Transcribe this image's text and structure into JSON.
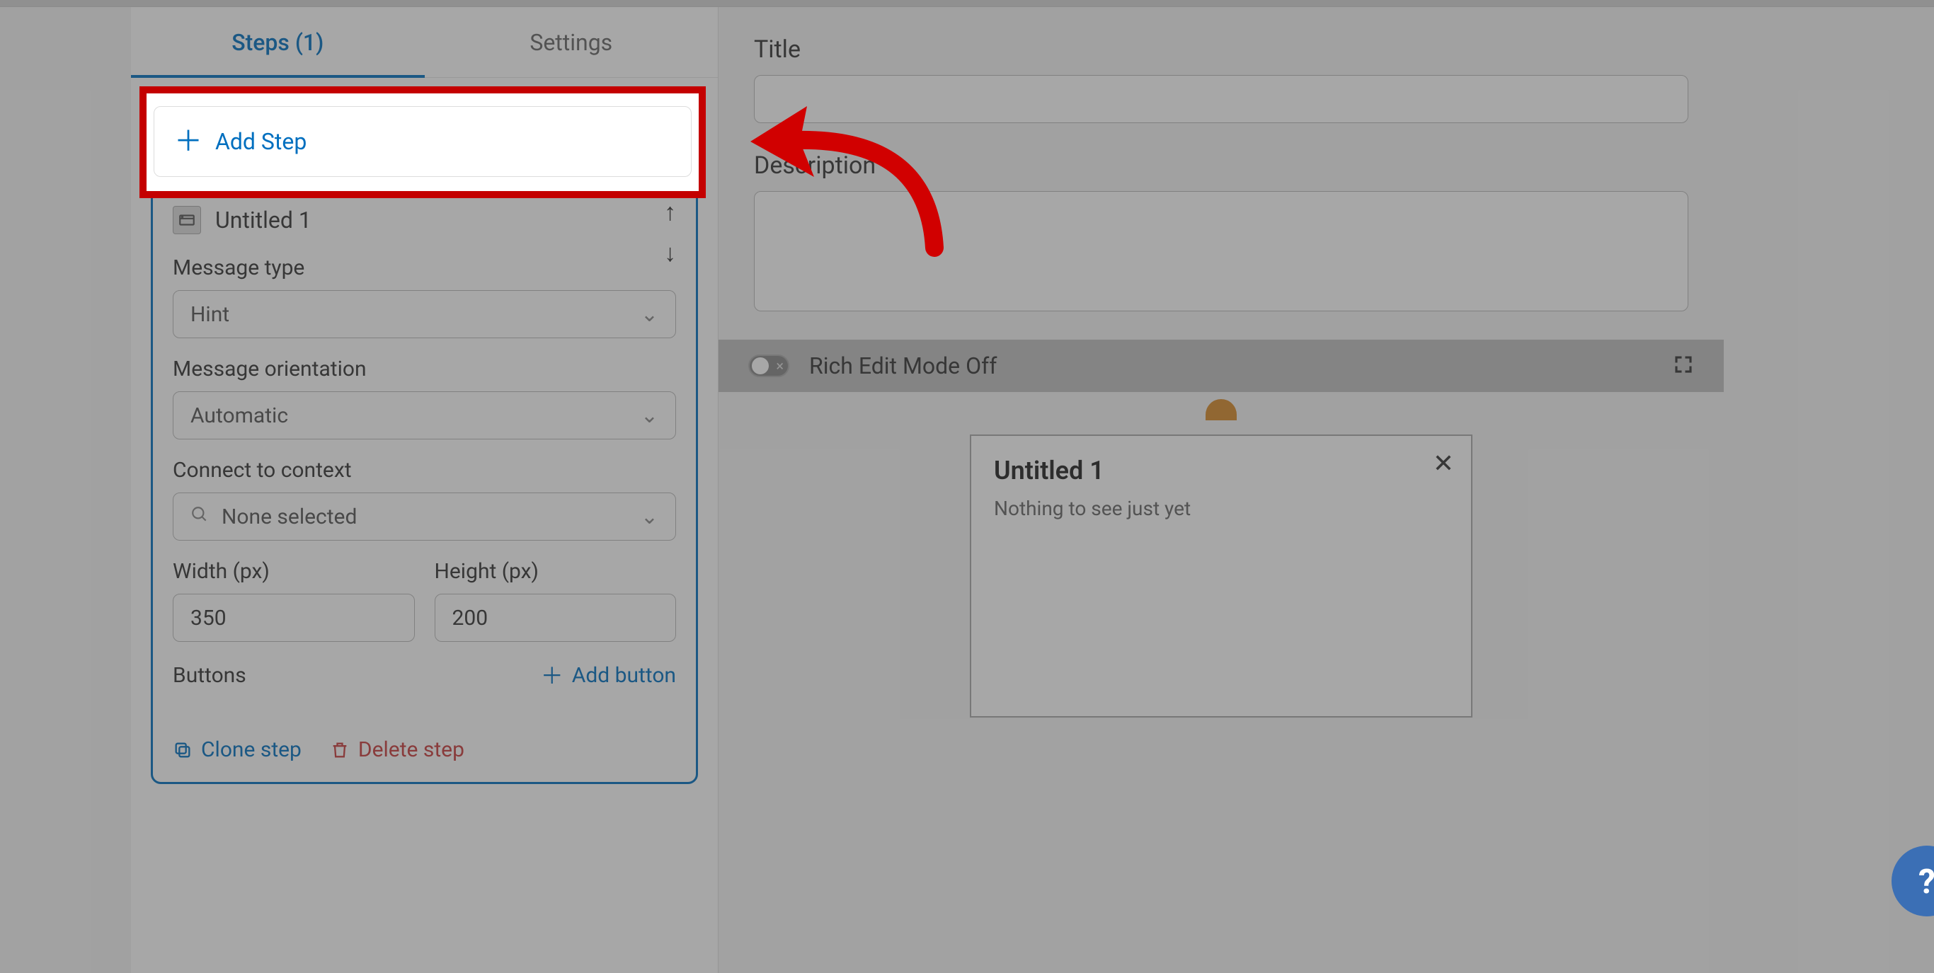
{
  "tabs": {
    "steps": "Steps (1)",
    "settings": "Settings"
  },
  "add_step_label": "Add Step",
  "step": {
    "title": "Untitled 1",
    "msg_type_label": "Message type",
    "msg_type_value": "Hint",
    "orientation_label": "Message orientation",
    "orientation_value": "Automatic",
    "context_label": "Connect to context",
    "context_value": "None selected",
    "width_label": "Width (px)",
    "width_value": "350",
    "height_label": "Height (px)",
    "height_value": "200",
    "buttons_label": "Buttons",
    "add_button_label": "Add button",
    "clone_label": "Clone step",
    "delete_label": "Delete step"
  },
  "form": {
    "title_label": "Title",
    "desc_label": "Description"
  },
  "richbar": {
    "label": "Rich Edit Mode Off"
  },
  "popup": {
    "title": "Untitled 1",
    "body": "Nothing to see just yet"
  },
  "help_fab": "?"
}
